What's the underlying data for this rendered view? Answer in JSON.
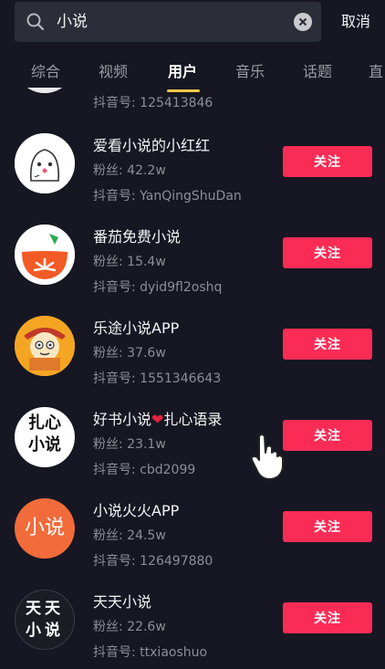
{
  "search": {
    "query": "小说",
    "cancel_label": "取消"
  },
  "tabs": [
    {
      "label": "综合"
    },
    {
      "label": "视频"
    },
    {
      "label": "用户",
      "active": true
    },
    {
      "label": "音乐"
    },
    {
      "label": "话题"
    },
    {
      "label": "直"
    }
  ],
  "users": [
    {
      "name": "",
      "fans": "",
      "douyin_id": "抖音号: 125413846"
    },
    {
      "name": "爱看小说的小红红",
      "fans": "粉丝: 42.2w",
      "douyin_id": "抖音号: YanQingShuDan",
      "follow_label": "关注"
    },
    {
      "name": "番茄免费小说",
      "fans": "粉丝: 15.4w",
      "douyin_id": "抖音号: dyid9fl2oshq",
      "follow_label": "关注"
    },
    {
      "name": "乐途小说APP",
      "fans": "粉丝: 37.6w",
      "douyin_id": "抖音号: 1551346643",
      "follow_label": "关注"
    },
    {
      "name_prefix": "好书小说",
      "name_suffix": "扎心语录",
      "heart": "❤",
      "fans": "粉丝: 23.1w",
      "douyin_id": "抖音号: cbd2099",
      "follow_label": "关注",
      "avatar_text": [
        "扎心",
        "小说"
      ]
    },
    {
      "name": "小说火火APP",
      "fans": "粉丝: 24.5w",
      "douyin_id": "抖音号: 126497880",
      "follow_label": "关注",
      "avatar_text": "小说"
    },
    {
      "name": "天天小说",
      "fans": "粉丝: 22.6w",
      "douyin_id": "抖音号: ttxiaoshuo",
      "follow_label": "关注",
      "avatar_text": [
        "天天",
        "小说"
      ]
    }
  ],
  "colors": {
    "background": "#161722",
    "follow_button": "#fa2c55",
    "active_tab_underline": "#f6c745"
  }
}
